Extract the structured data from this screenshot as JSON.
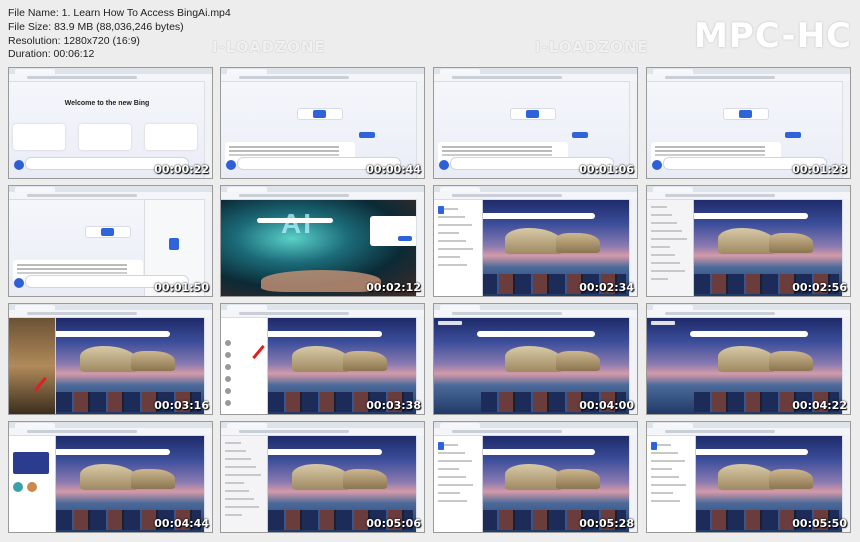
{
  "header": {
    "file_name": "File Name: 1. Learn How To Access BingAi.mp4",
    "file_size": "File Size: 83.9 MB (88,036,246 bytes)",
    "resolution": "Resolution: 1280x720 (16:9)",
    "duration": "Duration: 00:06:12"
  },
  "logo": "MPC-HC",
  "watermark": "I-LOADZONE",
  "welcome_text": "Welcome to the new Bing",
  "ai_text": "AI",
  "thumbnails": [
    {
      "time": "00:00:22",
      "kind": "chat-welcome"
    },
    {
      "time": "00:00:44",
      "kind": "chat"
    },
    {
      "time": "00:01:06",
      "kind": "chat"
    },
    {
      "time": "00:01:28",
      "kind": "chat"
    },
    {
      "time": "00:01:50",
      "kind": "chat-bing"
    },
    {
      "time": "00:02:12",
      "kind": "ai"
    },
    {
      "time": "00:02:34",
      "kind": "scene-panel"
    },
    {
      "time": "00:02:56",
      "kind": "scene-menu"
    },
    {
      "time": "00:03:16",
      "kind": "scene-photo"
    },
    {
      "time": "00:03:38",
      "kind": "scene-list"
    },
    {
      "time": "00:04:00",
      "kind": "scene"
    },
    {
      "time": "00:04:22",
      "kind": "scene"
    },
    {
      "time": "00:04:44",
      "kind": "scene-app"
    },
    {
      "time": "00:05:06",
      "kind": "scene-menu"
    },
    {
      "time": "00:05:28",
      "kind": "scene-panel"
    },
    {
      "time": "00:05:50",
      "kind": "scene-panel"
    }
  ]
}
